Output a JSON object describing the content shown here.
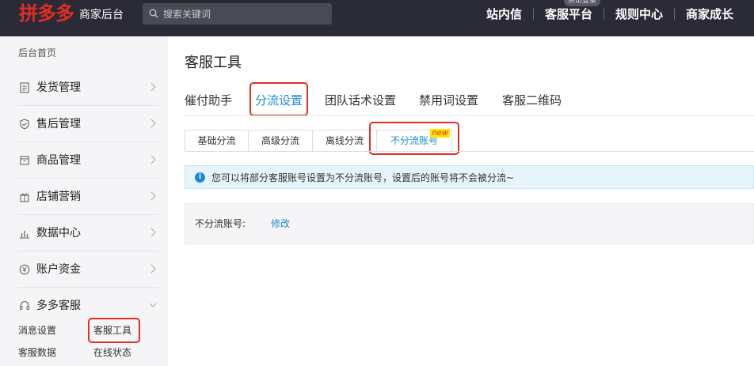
{
  "header": {
    "logo": "拼多多",
    "subtitle": "商家后台",
    "search": {
      "placeholder": "搜索关键词"
    },
    "nav": [
      {
        "label": "站内信"
      },
      {
        "label": "客服平台",
        "badge": "点击登录"
      },
      {
        "label": "规则中心"
      },
      {
        "label": "商家成长"
      }
    ]
  },
  "sidebar": {
    "home": "后台首页",
    "items": [
      {
        "label": "发货管理",
        "icon": "document-icon"
      },
      {
        "label": "售后管理",
        "icon": "shield-check-icon"
      },
      {
        "label": "商品管理",
        "icon": "box-icon"
      },
      {
        "label": "店铺营销",
        "icon": "gift-icon"
      },
      {
        "label": "数据中心",
        "icon": "bar-chart-icon"
      },
      {
        "label": "账户资金",
        "icon": "yen-coin-icon"
      },
      {
        "label": "多多客服",
        "icon": "headset-icon",
        "expanded": true
      }
    ],
    "sub_items": [
      {
        "label": "消息设置"
      },
      {
        "label": "客服工具",
        "active": true
      },
      {
        "label": "客服数据"
      },
      {
        "label": "在线状态"
      }
    ]
  },
  "main": {
    "title": "客服工具",
    "tabs": [
      {
        "label": "催付助手"
      },
      {
        "label": "分流设置",
        "active": true
      },
      {
        "label": "团队话术设置"
      },
      {
        "label": "禁用词设置"
      },
      {
        "label": "客服二维码"
      }
    ],
    "subtabs": [
      {
        "label": "基础分流"
      },
      {
        "label": "高级分流"
      },
      {
        "label": "离线分流"
      },
      {
        "label": "不分流账号",
        "active": true,
        "badge": "new"
      }
    ],
    "info": "您可以将部分客服账号设置为不分流账号，设置后的账号将不会被分流~",
    "field": {
      "label": "不分流账号:",
      "action": "修改"
    }
  },
  "colors": {
    "brand": "#e02e24",
    "accent": "#1e8ad6",
    "topbar": "#2b2b37",
    "sidebar": "#f5f5f7"
  }
}
